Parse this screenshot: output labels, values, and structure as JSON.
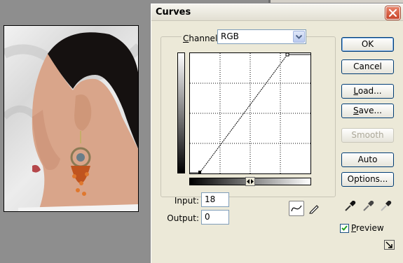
{
  "dialog": {
    "title": "Curves",
    "channel_label": "Channel:",
    "channel_label_access_key": "C",
    "channel_label_rest": "hannel:",
    "channel_value": "RGB",
    "input_label": "Input:",
    "input_value": "18",
    "output_label": "Output:",
    "output_value": "0",
    "buttons": {
      "ok": "OK",
      "cancel": "Cancel",
      "load": "Load...",
      "load_key": "L",
      "load_rest": "oad...",
      "save": "Save...",
      "save_key": "S",
      "save_rest": "ave...",
      "smooth": "Smooth",
      "auto": "Auto",
      "options": "Options..."
    },
    "preview_label": "Preview",
    "preview_key": "P",
    "preview_rest": "review",
    "preview_checked": true,
    "curve_points": [
      [
        18,
        0
      ],
      [
        255,
        255
      ]
    ]
  },
  "colors": {
    "accent": "#003c74",
    "close_button": "#c8452a",
    "dialog_bg": "#ece9d8"
  },
  "icons": [
    "close-icon",
    "dropdown-arrow-icon",
    "curve-tool-icon",
    "pencil-tool-icon",
    "black-eyedropper-icon",
    "gray-eyedropper-icon",
    "white-eyedropper-icon",
    "expand-icon"
  ]
}
